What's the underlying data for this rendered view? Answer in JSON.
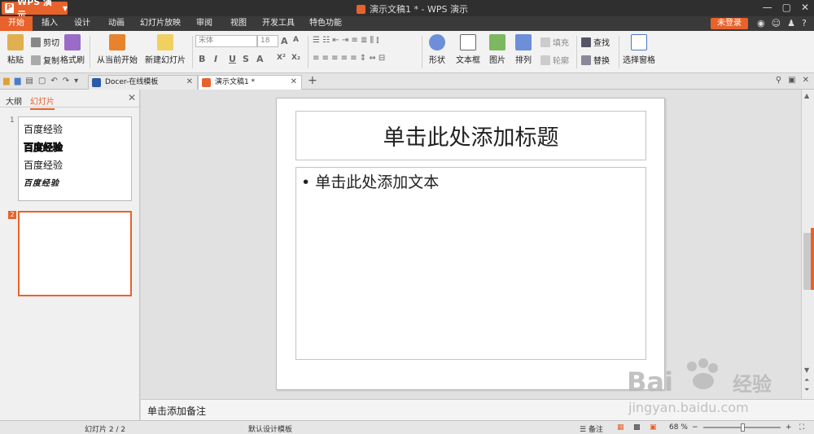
{
  "titlebar": {
    "app_name": "WPS 演示",
    "doc_title": "演示文稿1 * - WPS 演示",
    "win_controls": [
      "—",
      "▢",
      "✕"
    ]
  },
  "menu": {
    "tabs": [
      "开始",
      "插入",
      "设计",
      "动画",
      "幻灯片放映",
      "审阅",
      "视图",
      "开发工具",
      "特色功能"
    ],
    "active": "开始",
    "login": "未登录",
    "help": "?"
  },
  "ribbon": {
    "paste": "粘贴",
    "cut": "剪切",
    "copy": "复制",
    "format_painter": "格式刷",
    "from_current": "从当前开始",
    "new_slide": "新建幻灯片",
    "font_name": "宋体",
    "font_size": "18",
    "shape": "形状",
    "textbox": "文本框",
    "picture": "图片",
    "arrange": "排列",
    "fill": "填充",
    "outline": "轮廓",
    "find": "查找",
    "replace": "替换",
    "selection_pane": "选择窗格"
  },
  "tabs": {
    "docer": "Docer-在线模板",
    "document": "演示文稿1 *",
    "new_tab": "+"
  },
  "left_panel": {
    "tab_outline": "大纲",
    "tab_slides": "幻灯片",
    "slide1_number": "1",
    "slide1_lines": [
      "百度经验",
      "百度经验",
      "百度经验",
      "百度经验"
    ],
    "slide2_number": "2"
  },
  "slide": {
    "title_placeholder": "单击此处添加标题",
    "body_placeholder": "单击此处添加文本",
    "bullet": "•"
  },
  "notes": {
    "placeholder": "单击添加备注"
  },
  "status": {
    "slide_count": "幻灯片 2 / 2",
    "template": "默认设计模板",
    "notes_label": "备注",
    "zoom": "68 %",
    "zoom_value": 68
  },
  "watermark": {
    "brand": "Bai",
    "brand_end": "经验",
    "url": "jingyan.baidu.com"
  },
  "colors": {
    "accent": "#e8622c",
    "titlebar": "#2f2f2f"
  }
}
